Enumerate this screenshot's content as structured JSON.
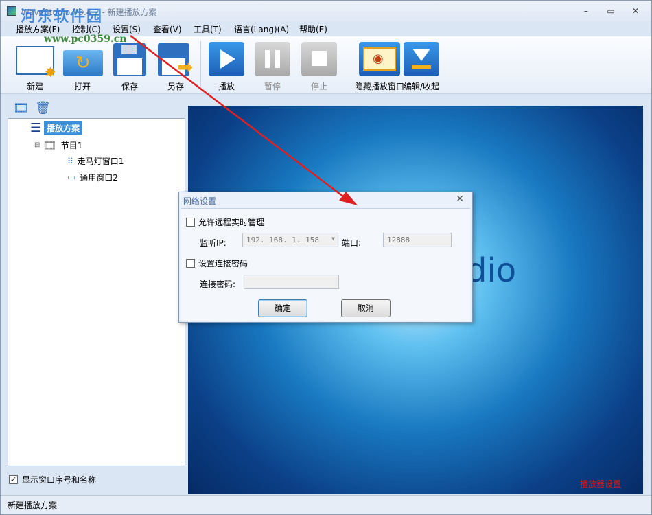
{
  "window": {
    "title": "WaveStudio V3.4.2 - 新建播放方案",
    "minimize": "–",
    "maximize": "▭",
    "close": "✕"
  },
  "watermark": {
    "site": "河东软件园",
    "url": "www.pc0359.cn"
  },
  "menu": [
    "播放方案(F)",
    "控制(C)",
    "设置(S)",
    "查看(V)",
    "工具(T)",
    "语言(Lang)(A)",
    "帮助(E)"
  ],
  "toolbar": {
    "new": "新建",
    "open": "打开",
    "save": "保存",
    "save_as": "另存",
    "play": "播放",
    "pause": "暂停",
    "stop": "停止",
    "hide": "隐藏播放窗口",
    "edit": "编辑/收起"
  },
  "tree": {
    "root": "播放方案",
    "program": "节目1",
    "win1": "走马灯窗口1",
    "win2": "通用窗口2"
  },
  "show_index": {
    "label": "显示窗口序号和名称",
    "checked": true
  },
  "preview": {
    "text": "dio",
    "link": "播放器设置"
  },
  "status": "新建播放方案",
  "dialog": {
    "title": "网络设置",
    "close": "✕",
    "allow_remote": "允许远程实时管理",
    "listen_ip_label": "监听IP:",
    "listen_ip": "192. 168. 1. 158",
    "port_label": "端口:",
    "port": "12888",
    "set_password": "设置连接密码",
    "password_label": "连接密码:",
    "password": "",
    "ok": "确定",
    "cancel": "取消"
  },
  "colors": {
    "accent": "#3b8fd9",
    "arrow": "#e02020",
    "link": "#d81818"
  }
}
